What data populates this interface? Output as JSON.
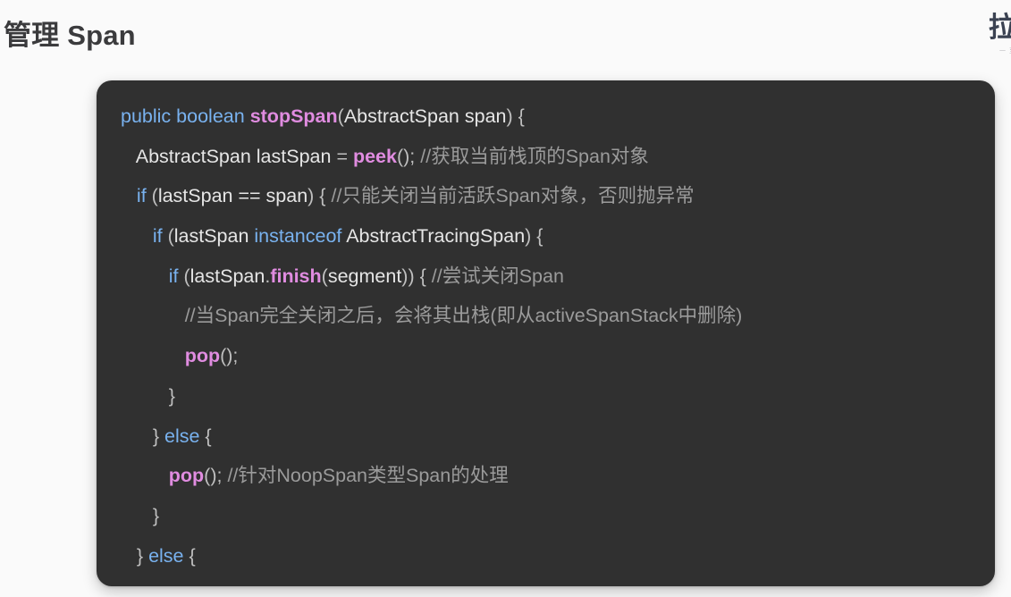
{
  "header": {
    "title": "管理 Span",
    "right_title": "拉",
    "right_sub": "一 至"
  },
  "code_block": {
    "language": "java",
    "background_color": "#303030",
    "colors": {
      "keyword": "#79b2ef",
      "function": "#e08ce0",
      "identifier": "#e6e6e6",
      "punctuation": "#bfbfbf",
      "comment": "#9b9b9b"
    },
    "lines": [
      {
        "indent": 0,
        "tokens": [
          {
            "t": "public",
            "c": "kw"
          },
          {
            "t": " ",
            "c": "plain"
          },
          {
            "t": "boolean",
            "c": "kw"
          },
          {
            "t": " ",
            "c": "plain"
          },
          {
            "t": "stopSpan",
            "c": "fn"
          },
          {
            "t": "(",
            "c": "punc"
          },
          {
            "t": "AbstractSpan span",
            "c": "ident"
          },
          {
            "t": ") {",
            "c": "punc"
          }
        ]
      },
      {
        "indent": 1,
        "tokens": [
          {
            "t": "AbstractSpan lastSpan ",
            "c": "ident"
          },
          {
            "t": "= ",
            "c": "punc"
          },
          {
            "t": "peek",
            "c": "fn"
          },
          {
            "t": "(); ",
            "c": "punc"
          },
          {
            "t": "//获取当前栈顶的Span对象",
            "c": "cmt"
          }
        ]
      },
      {
        "indent": 1,
        "tokens": [
          {
            "t": "if",
            "c": "kw"
          },
          {
            "t": " (",
            "c": "punc"
          },
          {
            "t": "lastSpan == span",
            "c": "ident"
          },
          {
            "t": ") { ",
            "c": "punc"
          },
          {
            "t": "//只能关闭当前活跃Span对象，否则抛异常",
            "c": "cmt"
          }
        ]
      },
      {
        "indent": 2,
        "tokens": [
          {
            "t": "if",
            "c": "kw"
          },
          {
            "t": " (",
            "c": "punc"
          },
          {
            "t": "lastSpan ",
            "c": "ident"
          },
          {
            "t": "instanceof",
            "c": "kw"
          },
          {
            "t": " AbstractTracingSpan",
            "c": "ident"
          },
          {
            "t": ") {",
            "c": "punc"
          }
        ]
      },
      {
        "indent": 3,
        "tokens": [
          {
            "t": "if",
            "c": "kw"
          },
          {
            "t": " (",
            "c": "punc"
          },
          {
            "t": "lastSpan",
            "c": "ident"
          },
          {
            "t": ".",
            "c": "punc"
          },
          {
            "t": "finish",
            "c": "fn"
          },
          {
            "t": "(",
            "c": "punc"
          },
          {
            "t": "segment",
            "c": "ident"
          },
          {
            "t": ")) { ",
            "c": "punc"
          },
          {
            "t": "//尝试关闭Span",
            "c": "cmt"
          }
        ]
      },
      {
        "indent": 4,
        "tokens": [
          {
            "t": "//当Span完全关闭之后，会将其出栈(即从activeSpanStack中删除)",
            "c": "cmt"
          }
        ]
      },
      {
        "indent": 4,
        "tokens": [
          {
            "t": "pop",
            "c": "fn"
          },
          {
            "t": "();",
            "c": "punc"
          }
        ]
      },
      {
        "indent": 3,
        "tokens": [
          {
            "t": "}",
            "c": "punc"
          }
        ]
      },
      {
        "indent": 2,
        "tokens": [
          {
            "t": "} ",
            "c": "punc"
          },
          {
            "t": "else",
            "c": "kw"
          },
          {
            "t": " {",
            "c": "punc"
          }
        ]
      },
      {
        "indent": 3,
        "tokens": [
          {
            "t": "pop",
            "c": "fn"
          },
          {
            "t": "(); ",
            "c": "punc"
          },
          {
            "t": "//针对NoopSpan类型Span的处理",
            "c": "cmt"
          }
        ]
      },
      {
        "indent": 2,
        "tokens": [
          {
            "t": "}",
            "c": "punc"
          }
        ]
      },
      {
        "indent": 1,
        "tokens": [
          {
            "t": "} ",
            "c": "punc"
          },
          {
            "t": "else",
            "c": "kw"
          },
          {
            "t": " {",
            "c": "punc"
          }
        ]
      }
    ]
  }
}
